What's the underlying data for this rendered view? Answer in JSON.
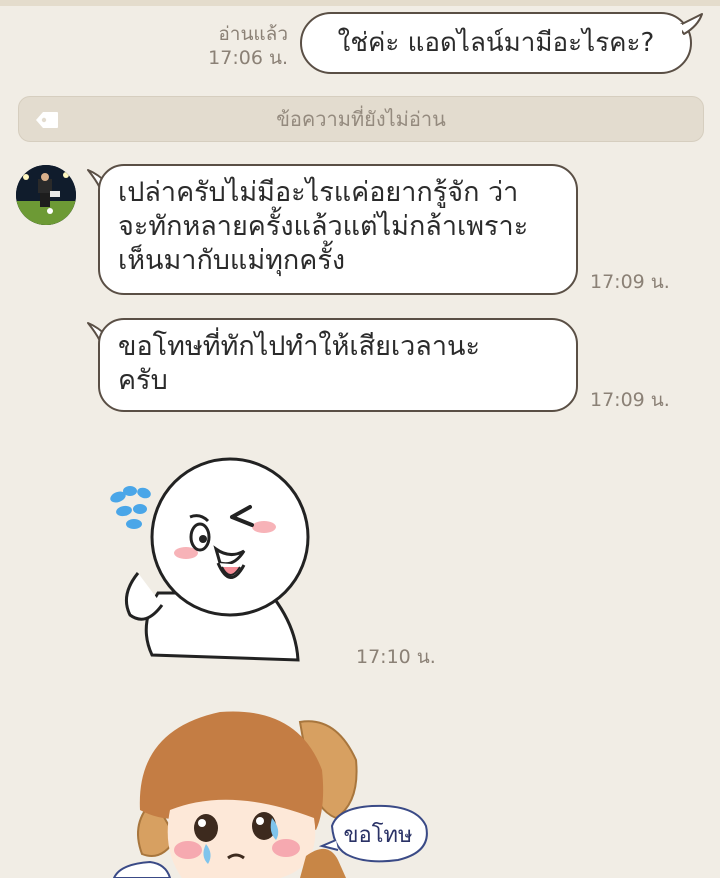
{
  "chat": {
    "outgoing": {
      "text": "ใช่ค่ะ แอดไลน์มามีอะไรคะ?",
      "read_label": "อ่านแล้ว",
      "time": "17:06 น."
    },
    "unread_divider": "ข้อความที่ยังไม่อ่าน",
    "incoming": [
      {
        "lines": [
          "เปล่าครับไม่มีอะไรแค่อยากรู้จัก ว่า",
          "จะทักหลายครั้งแล้วแต่ไม่กล้าเพราะ",
          "เห็นมากับแม่ทุกครั้ง"
        ],
        "time": "17:09 น."
      },
      {
        "lines": [
          "ขอโทษที่ทักไปทำให้เสียเวลานะ",
          "ครับ"
        ],
        "time": "17:09 น."
      }
    ],
    "stickers": [
      {
        "icon": "sweating-wink-sticker",
        "time": "17:10 น."
      },
      {
        "icon": "crying-boy-sorry-sticker",
        "caption": "ขอโทษ"
      }
    ]
  },
  "colors": {
    "background": "#f1ede5",
    "bubble": "#ffffff",
    "bubble_border": "#5a4f45",
    "meta_text": "#8b8176",
    "divider_bg": "#e3dccf"
  }
}
